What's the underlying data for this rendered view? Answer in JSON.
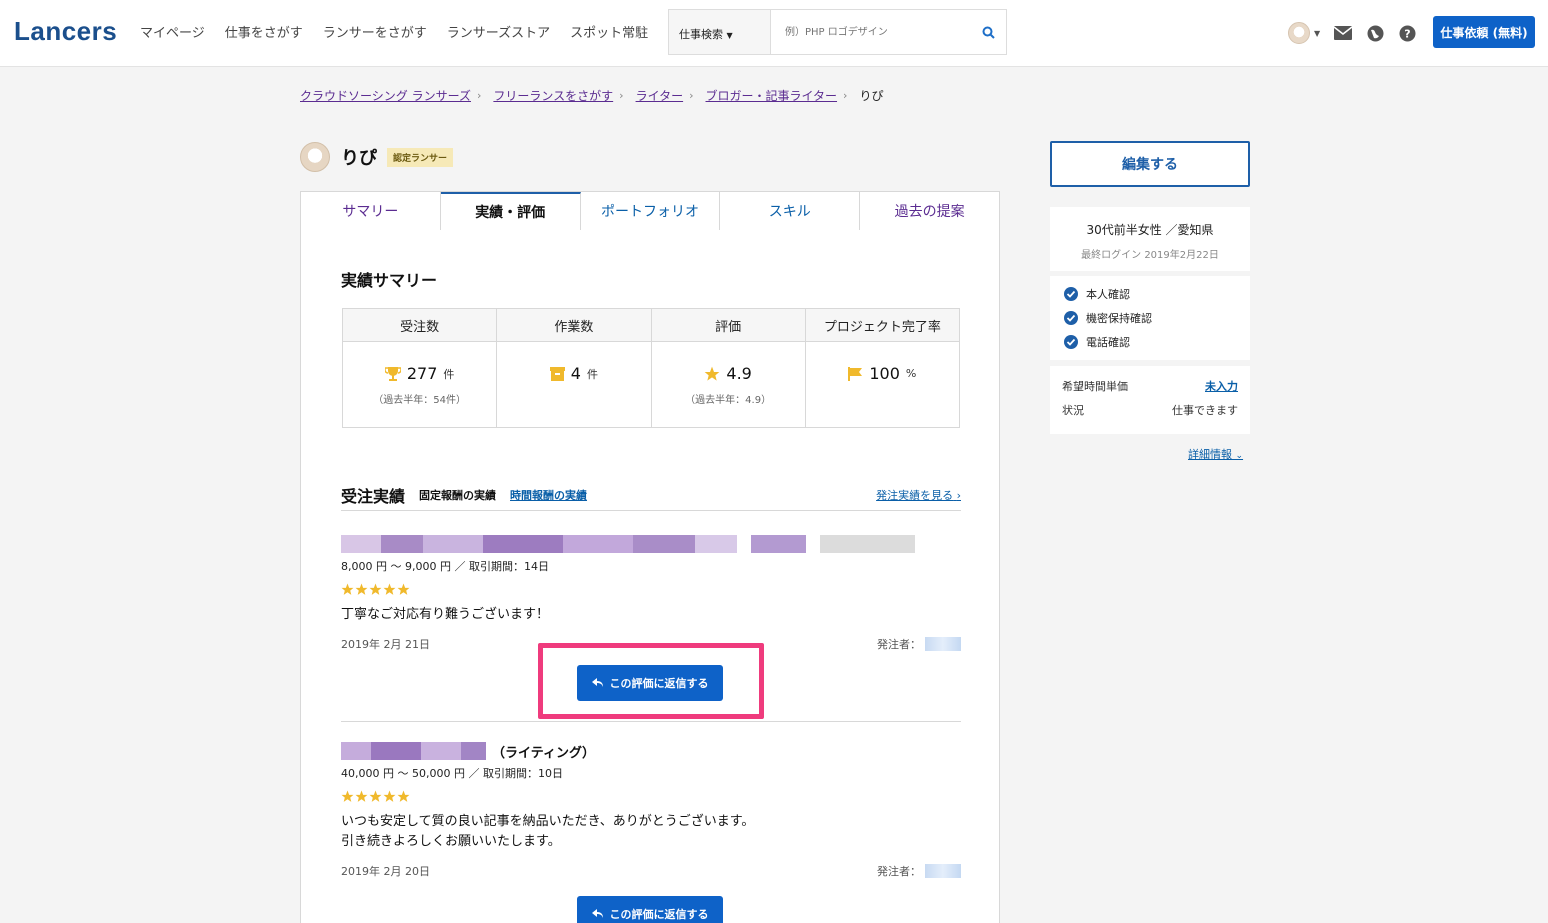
{
  "header": {
    "logo": "Lancers",
    "nav": [
      "マイページ",
      "仕事をさがす",
      "ランサーをさがす",
      "ランサーズストア",
      "スポット常駐"
    ],
    "search_type": "仕事検索",
    "search_placeholder": "例）PHP ロゴデザイン",
    "order_button": "仕事依頼 (無料)"
  },
  "breadcrumb": {
    "items": [
      "クラウドソーシング ランサーズ",
      "フリーランスをさがす",
      "ライター",
      "ブロガー・記事ライター"
    ],
    "current": "りぴ"
  },
  "profile": {
    "name": "りぴ",
    "badge": "認定ランサー"
  },
  "tabs": [
    "サマリー",
    "実績・評価",
    "ポートフォリオ",
    "スキル",
    "過去の提案"
  ],
  "summary": {
    "title": "実績サマリー",
    "columns": [
      {
        "head": "受注数",
        "value": "277",
        "unit": "件",
        "sub": "（過去半年：54件）"
      },
      {
        "head": "作業数",
        "value": "4",
        "unit": "件",
        "sub": ""
      },
      {
        "head": "評価",
        "value": "4.9",
        "unit": "",
        "sub": "（過去半年：4.9）"
      },
      {
        "head": "プロジェクト完了率",
        "value": "100",
        "unit": "%",
        "sub": ""
      }
    ]
  },
  "orders": {
    "title": "受注実績",
    "fixed": "固定報酬の実績",
    "hourly": "時間報酬の実績",
    "link": "発注実績を見る",
    "entries": [
      {
        "title_suffix": "",
        "price": "8,000 円 〜 9,000 円 ／ 取引期間：14日",
        "rating": 5,
        "comment1": "丁寧なご対応有り難うございます！",
        "comment2": "",
        "date": "2019年 2月 21日",
        "client_label": "発注者：",
        "reply": "この評価に返信する"
      },
      {
        "title_suffix": "（ライティング）",
        "price": "40,000 円 〜 50,000 円 ／ 取引期間：10日",
        "rating": 5,
        "comment1": "いつも安定して質の良い記事を納品いただき、ありがとうございます。",
        "comment2": "引き続きよろしくお願いいたします。",
        "date": "2019年 2月 20日",
        "client_label": "発注者：",
        "reply": "この評価に返信する"
      }
    ]
  },
  "sidebar": {
    "edit": "編集する",
    "demographic": "30代前半女性 ／愛知県",
    "last_login": "最終ログイン 2019年2月22日",
    "verifications": [
      "本人確認",
      "機密保持確認",
      "電話確認"
    ],
    "rate_label": "希望時間単価",
    "rate_value": "未入力",
    "status_label": "状況",
    "status_value": "仕事できます",
    "detail": "詳細情報"
  },
  "colors": {
    "brand": "#1b4f8c",
    "primary": "#0e62c8",
    "highlight": "#ef3b7d",
    "star": "#f0b92c"
  }
}
